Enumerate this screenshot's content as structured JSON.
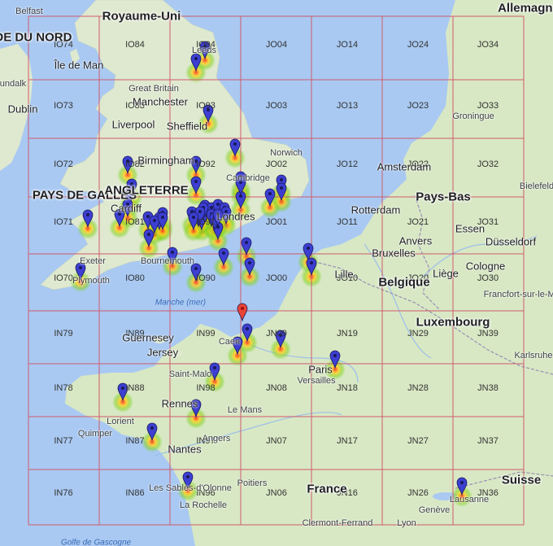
{
  "map": {
    "colors": {
      "sea": "#a9c9f2",
      "land": "#e8efdd",
      "green_land": "#cfe3bd",
      "grid_line": "#d05a6e",
      "pin": "#3c3fd1",
      "pin_selected": "#ea4335",
      "heat_outer": "#7ed321",
      "heat_inner": "#ff3b1f"
    },
    "country_labels": [
      "Royaume-Uni",
      "PAYS DE GALLES",
      "ANGLETERRE",
      "Pays-Bas",
      "Belgique",
      "Luxembourg",
      "France",
      "Suisse",
      "IRLANDE DU NORD",
      "Allemagne"
    ],
    "island_labels": [
      "Île de Man",
      "Guernesey",
      "Jersey"
    ],
    "sea_labels": [
      "Manche (mer)",
      "Golfe de Gascogne"
    ],
    "major_cities": [
      "Manchester",
      "Liverpool",
      "Sheffield",
      "Birmingham",
      "Londres",
      "Dublin",
      "Cardiff",
      "Rotterdam",
      "Amsterdam",
      "Bruxelles",
      "Anvers",
      "Essen",
      "Cologne",
      "Düsseldorf",
      "Paris",
      "Nantes",
      "Rennes",
      "Lille",
      "Liège"
    ],
    "minor_cities": [
      "Great Britain",
      "Norwich",
      "Cambridge",
      "Exeter",
      "Plymouth",
      "Bournemouth",
      "Caen",
      "Saint-Malo",
      "Le Mans",
      "Angers",
      "Lorient",
      "Quimper",
      "Versailles",
      "Poitiers",
      "La Rochelle",
      "Les Sables-d'Olonne",
      "Clermont-Ferrand",
      "Lyon",
      "Genève",
      "Lausanne",
      "Groningue",
      "Bielefeld",
      "Francfort-sur-le-Main",
      "Karlsruhe",
      "Dundalk",
      "Belfast",
      "Leeds"
    ],
    "grid_squares": [
      "IO74",
      "IO84",
      "IO94",
      "JO04",
      "JO14",
      "JO24",
      "JO34",
      "IO73",
      "IO83",
      "IO93",
      "JO03",
      "JO13",
      "JO23",
      "JO33",
      "IO72",
      "IO82",
      "IO92",
      "JO02",
      "JO12",
      "JO22",
      "JO32",
      "IO71",
      "IO81",
      "IO91",
      "JO01",
      "JO11",
      "JO21",
      "JO31",
      "IO70",
      "IO80",
      "IO90",
      "JO00",
      "JO10",
      "JO20",
      "JO30",
      "IN79",
      "IN89",
      "IN99",
      "JN09",
      "JN19",
      "JN29",
      "JN39",
      "IN78",
      "IN88",
      "IN98",
      "JN08",
      "JN18",
      "JN28",
      "JN38",
      "IN77",
      "IN87",
      "IN97",
      "JN07",
      "JN17",
      "JN27",
      "JN37",
      "IN76",
      "IN86",
      "IN96",
      "JN06",
      "JN16",
      "JN26",
      "JN36"
    ],
    "station_count": 57,
    "selected_station_count": 1
  }
}
